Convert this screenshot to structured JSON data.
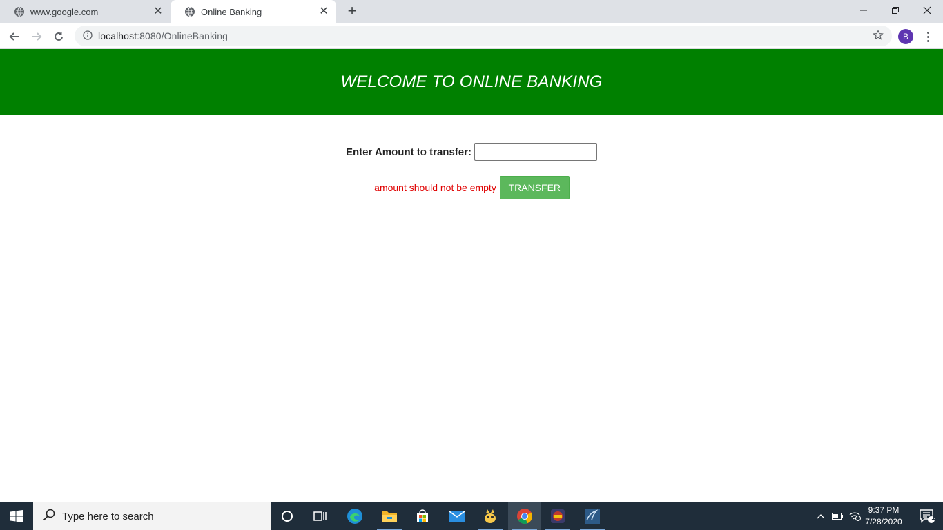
{
  "browser": {
    "tabs": [
      {
        "title": "www.google.com",
        "active": false
      },
      {
        "title": "Online Banking",
        "active": true
      }
    ],
    "address": {
      "host": "localhost",
      "path": ":8080/OnlineBanking"
    },
    "profile_initial": "B"
  },
  "page": {
    "banner_title": "WELCOME TO ONLINE BANKING",
    "amount_label": "Enter Amount to transfer:",
    "amount_value": "",
    "error_message": "amount should not be empty",
    "transfer_button": "TRANSFER",
    "colors": {
      "banner": "#008000",
      "button": "#5cb85c",
      "error": "#e00000"
    }
  },
  "taskbar": {
    "search_placeholder": "Type here to search",
    "pinned_icons": [
      "cortana-icon",
      "task-view-icon",
      "edge-icon",
      "file-explorer-icon",
      "store-icon",
      "mail-icon",
      "app-icon",
      "chrome-icon",
      "app-icon-2",
      "mysql-workbench-icon"
    ],
    "time": "9:37 PM",
    "date": "7/28/2020",
    "notification_count": "1"
  }
}
